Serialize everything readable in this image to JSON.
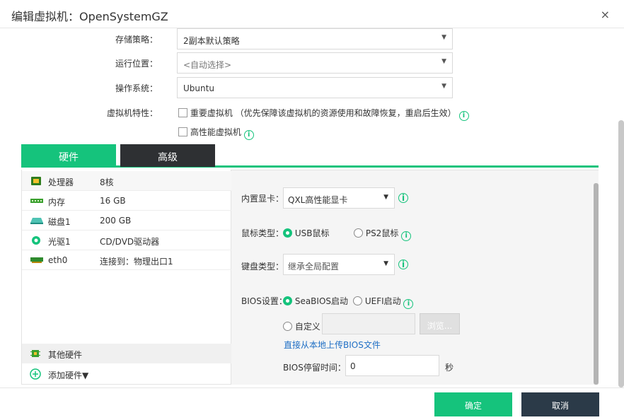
{
  "dialog": {
    "title": "编辑虚拟机：OpenSystemGZ",
    "close": "×"
  },
  "form": {
    "storage_policy": {
      "label": "存储策略：",
      "value": "2副本默认策略"
    },
    "run_location": {
      "label": "运行位置：",
      "value": "<自动选择>"
    },
    "os": {
      "label": "操作系统：",
      "value": "Ubuntu"
    },
    "features": {
      "label": "虚拟机特性：",
      "important_vm": "重要虚拟机",
      "important_vm_note": "（优先保障该虚拟机的资源使用和故障恢复，重启后生效）",
      "high_perf_vm": "高性能虚拟机"
    }
  },
  "tabs": [
    {
      "label": "硬件",
      "active": true
    },
    {
      "label": "高级",
      "active": false
    }
  ],
  "hardware": {
    "items": [
      {
        "name": "处理器",
        "value": "8核",
        "icon": "cpu-icon"
      },
      {
        "name": "内存",
        "value": "16 GB",
        "icon": "memory-icon"
      },
      {
        "name": "磁盘1",
        "value": "200 GB",
        "icon": "disk-icon"
      },
      {
        "name": "光驱1",
        "value": "CD/DVD驱动器",
        "icon": "cdrom-icon"
      },
      {
        "name": "eth0",
        "value": "连接到：物理出口1",
        "icon": "nic-icon"
      }
    ],
    "other": "其他硬件",
    "add": "添加硬件▼"
  },
  "detail": {
    "gpu": {
      "label": "内置显卡：",
      "value": "QXL高性能显卡"
    },
    "mouse": {
      "label": "鼠标类型：",
      "opt1": "USB鼠标",
      "opt2": "PS2鼠标"
    },
    "keyboard": {
      "label": "键盘类型：",
      "value": "继承全局配置"
    },
    "bios": {
      "label": "BIOS设置：",
      "opt1": "SeaBIOS启动",
      "opt2": "UEFI启动",
      "custom": "自定义",
      "browse": "浏览...",
      "upload_link": "直接从本地上传BIOS文件",
      "delay_label": "BIOS停留时间：",
      "delay_value": "0",
      "delay_unit": "秒"
    }
  },
  "footer": {
    "ok": "确定",
    "cancel": "取消"
  },
  "colors": {
    "accent": "#15c37c",
    "dark_tab": "#2e3033",
    "cancel_bg": "#2b3a48",
    "link": "#1f6fc5"
  },
  "icons": {
    "info": "i"
  }
}
